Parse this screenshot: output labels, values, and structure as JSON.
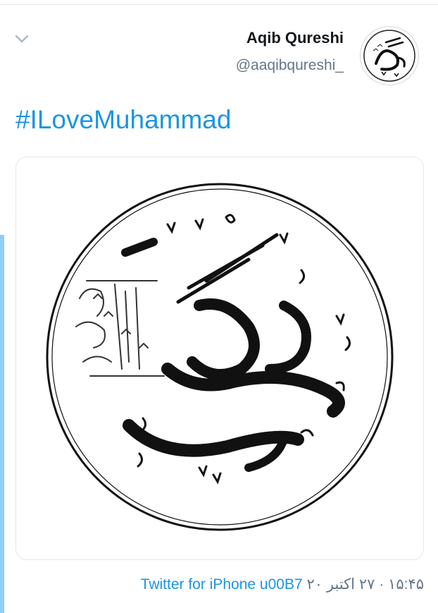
{
  "tweet": {
    "display_name": "Aqib Qureshi",
    "handle": "@aaqibqureshi_",
    "text": "#ILoveMuhammad",
    "source": "Twitter for iPhone",
    "separator": "u00B7",
    "timestamp": "۱۵:۴۵ · ۲۷ اکتبر ۲۰"
  },
  "icons": {
    "menu": "chevron-down-icon",
    "avatar": "calligraphy-avatar",
    "media": "muhammad-calligraphy-image"
  },
  "colors": {
    "link": "#1b95e0",
    "secondary_text": "#657786",
    "thread_line": "#8ecdf8",
    "border": "#e1e8ed"
  }
}
